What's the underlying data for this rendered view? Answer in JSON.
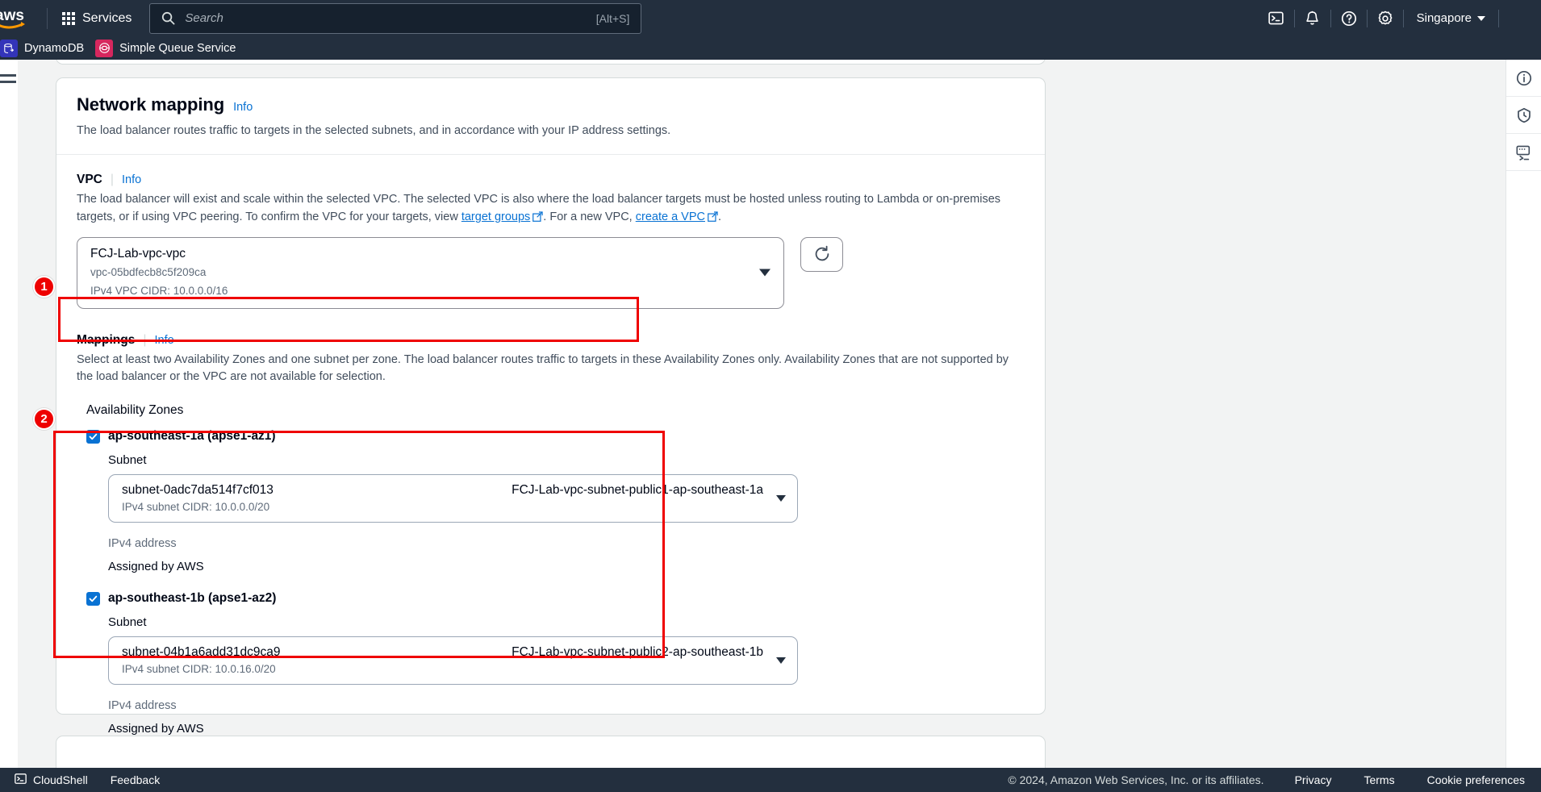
{
  "topnav": {
    "logo_alt": "aws",
    "services_label": "Services",
    "search": {
      "placeholder": "Search",
      "shortcut": "[Alt+S]"
    },
    "icons": [
      "cloudshell-icon",
      "notifications-bell-icon",
      "help-question-icon",
      "settings-gear-icon"
    ],
    "region": "Singapore"
  },
  "favorites": [
    {
      "label": "DynamoDB",
      "icon": "dynamodb-icon"
    },
    {
      "label": "Simple Queue Service",
      "icon": "sqs-icon"
    }
  ],
  "right_rail": [
    "info-circle-icon",
    "shield-clock-icon",
    "cloudshell-terminal-icon"
  ],
  "card": {
    "title": "Network mapping",
    "info_label": "Info",
    "description": "The load balancer routes traffic to targets in the selected subnets, and in accordance with your IP address settings."
  },
  "vpc": {
    "label": "VPC",
    "info_label": "Info",
    "description_part1": "The load balancer will exist and scale within the selected VPC. The selected VPC is also where the load balancer targets must be hosted unless routing to Lambda or on-premises targets, or if using VPC peering. To confirm the VPC for your targets, view ",
    "link_target_groups": "target groups",
    "description_part2": ". For a new VPC, ",
    "link_create_vpc": "create a VPC",
    "description_part3": ".",
    "selected_name": "FCJ-Lab-vpc-vpc",
    "selected_id": "vpc-05bdfecb8c5f209ca",
    "selected_cidr": "IPv4 VPC CIDR: 10.0.0.0/16",
    "refresh_label": "refresh-icon"
  },
  "mappings": {
    "label": "Mappings",
    "info_label": "Info",
    "description": "Select at least two Availability Zones and one subnet per zone. The load balancer routes traffic to targets in these Availability Zones only. Availability Zones that are not supported by the load balancer or the VPC are not available for selection.",
    "section_title": "Availability Zones",
    "zones": [
      {
        "checked": true,
        "name": "ap-southeast-1a (apse1-az1)",
        "subnet_label": "Subnet",
        "subnet_id": "subnet-0adc7da514f7cf013",
        "subnet_name": "FCJ-Lab-vpc-subnet-public1-ap-southeast-1a",
        "subnet_cidr": "IPv4 subnet CIDR: 10.0.0.0/20",
        "ipv4_label": "IPv4 address",
        "ipv4_value": "Assigned by AWS"
      },
      {
        "checked": true,
        "name": "ap-southeast-1b (apse1-az2)",
        "subnet_label": "Subnet",
        "subnet_id": "subnet-04b1a6add31dc9ca9",
        "subnet_name": "FCJ-Lab-vpc-subnet-public2-ap-southeast-1b",
        "subnet_cidr": "IPv4 subnet CIDR: 10.0.16.0/20",
        "ipv4_label": "IPv4 address",
        "ipv4_value": "Assigned by AWS"
      }
    ]
  },
  "annotations": [
    {
      "number": "1",
      "target": "vpc-select"
    },
    {
      "number": "2",
      "target": "availability-zones-block"
    }
  ],
  "footer": {
    "cloudshell_label": "CloudShell",
    "feedback_label": "Feedback",
    "copyright": "© 2024, Amazon Web Services, Inc. or its affiliates.",
    "privacy_label": "Privacy",
    "terms_label": "Terms",
    "cookie_label": "Cookie preferences"
  },
  "colors": {
    "nav_bg": "#232f3e",
    "link_blue": "#0972d3",
    "highlight_red": "#ef0000",
    "checkbox_blue": "#0972d3"
  }
}
